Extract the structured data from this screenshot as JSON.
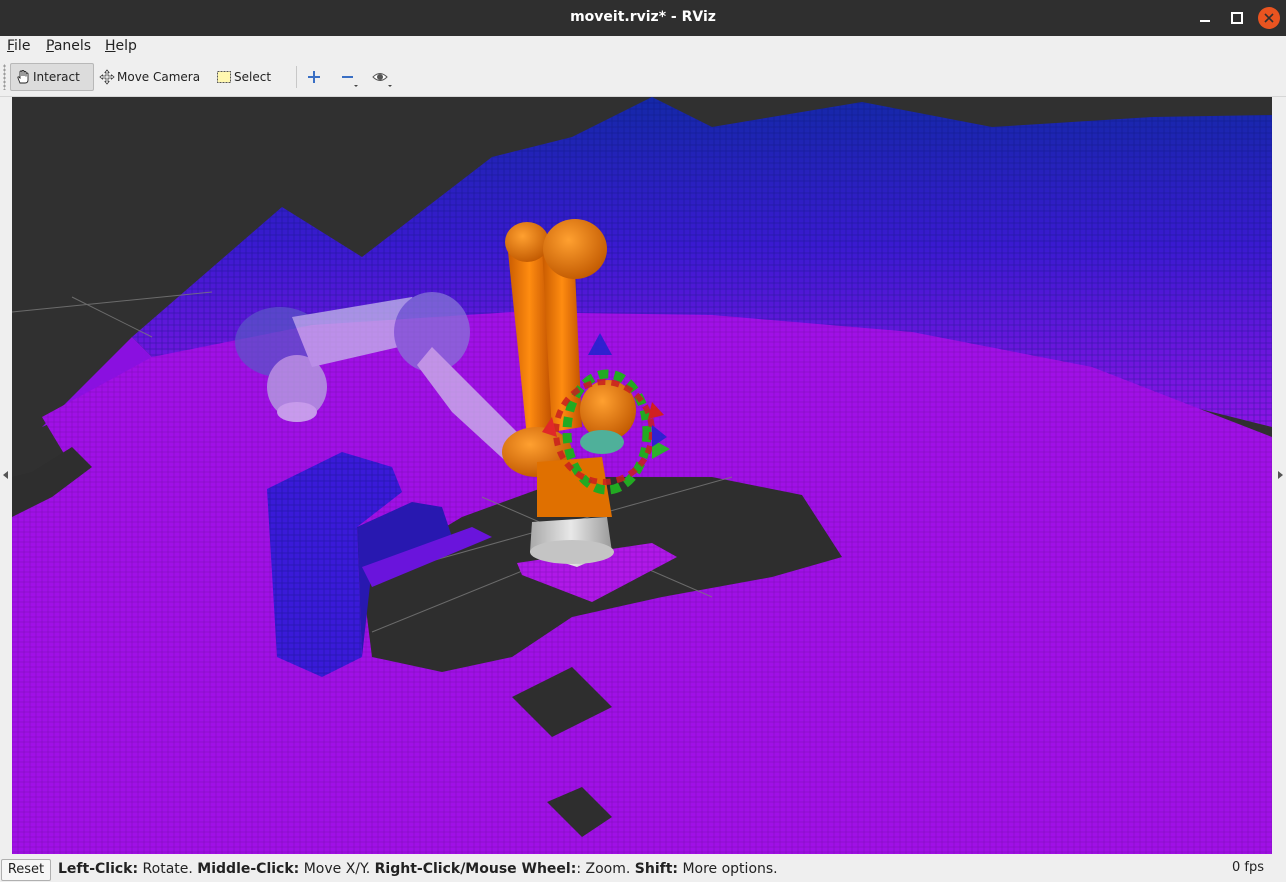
{
  "window": {
    "title": "moveit.rviz* - RViz"
  },
  "menu": {
    "file": "File",
    "panels": "Panels",
    "help": "Help"
  },
  "toolbar": {
    "interact": "Interact",
    "move_camera": "Move Camera",
    "select": "Select",
    "icons": [
      "hand-icon",
      "move-camera-icon",
      "select-box-icon",
      "plus-icon",
      "minus-icon",
      "eye-icon"
    ]
  },
  "status": {
    "reset": "Reset",
    "hints": [
      {
        "key": "Left-Click:",
        "action": "Rotate."
      },
      {
        "key": "Middle-Click:",
        "action": "Move X/Y."
      },
      {
        "key": "Right-Click/Mouse Wheel:",
        "action": ": Zoom."
      },
      {
        "key": "Shift:",
        "action": "More options."
      }
    ],
    "fps": "0 fps"
  },
  "colors": {
    "titlebar": "#2f2f2f",
    "close": "#e95420",
    "octomap_low": "#a010e0",
    "octomap_high": "#1020b0",
    "robot_orange": "#f07a00",
    "ghost_robot": "#c8b8e8"
  }
}
